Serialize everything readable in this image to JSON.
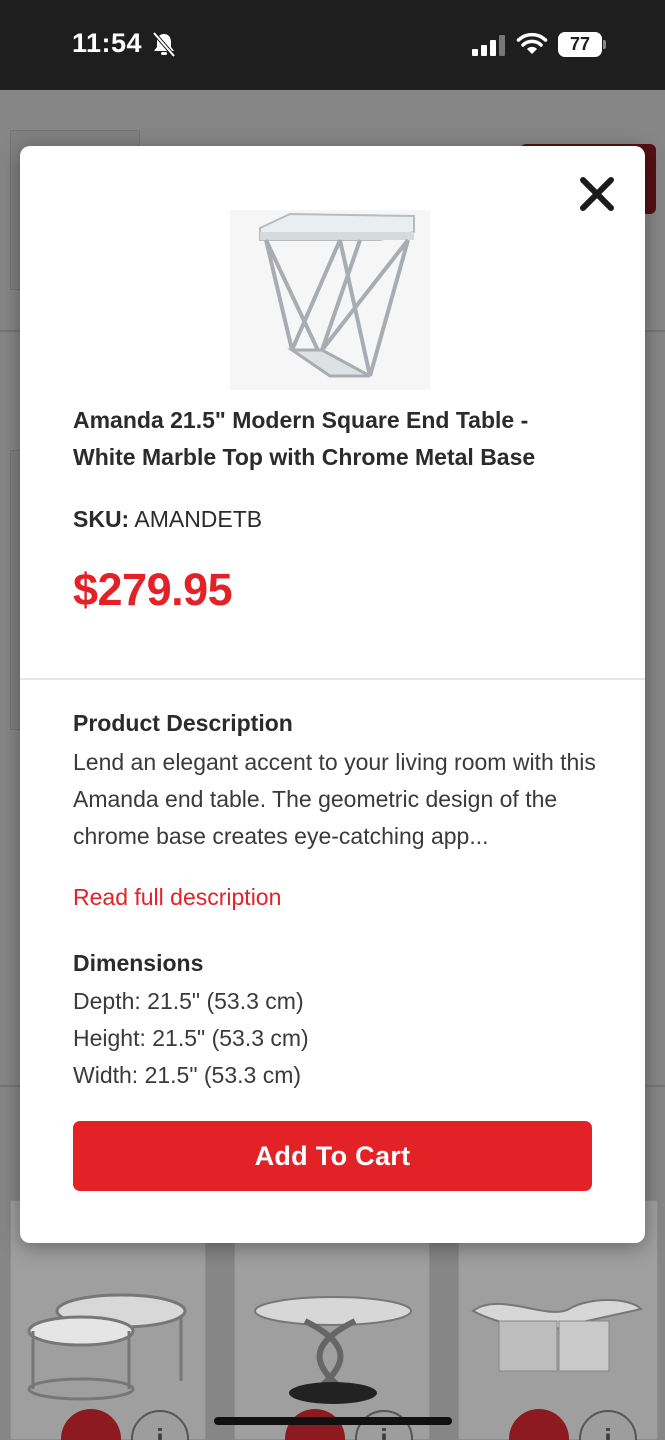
{
  "status_bar": {
    "time": "11:54",
    "battery": "77"
  },
  "modal": {
    "product_title": "Amanda 21.5\" Modern Square End Table - White Marble Top with Chrome Metal Base",
    "sku_label": "SKU:",
    "sku_value": "AMANDETB",
    "price": "$279.95",
    "description_heading": "Product Description",
    "description_text": "Lend an elegant accent to your living room with this Amanda end table. The geometric design of the chrome base creates eye-catching app...",
    "read_more": "Read full description",
    "dimensions_heading": "Dimensions",
    "dimensions": [
      "Depth: 21.5\" (53.3 cm)",
      "Height: 21.5\" (53.3 cm)",
      "Width: 21.5\" (53.3 cm)"
    ],
    "add_to_cart": "Add To Cart"
  },
  "background": {
    "info_glyph": "i"
  },
  "colors": {
    "accent_red": "#e32228",
    "status_bar": "#1e1e1e"
  },
  "icons": {
    "close": "close-icon",
    "bell": "bell-muted-icon",
    "signal": "signal-icon",
    "wifi": "wifi-icon",
    "battery": "battery-icon"
  }
}
